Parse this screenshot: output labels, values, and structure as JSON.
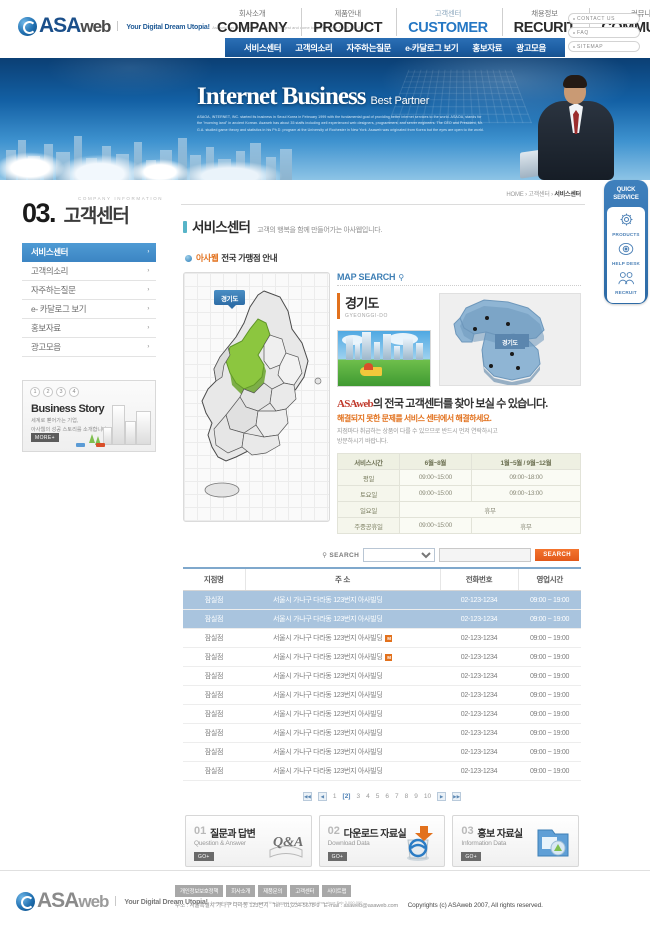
{
  "header": {
    "logo": {
      "brand": "ASA",
      "brand_sub": "web",
      "tagline": "Your Digital Dream Utopia!",
      "tagline_accent": "Utopia!",
      "tagline_sub": "Asaweb has been serving one of the biggest and come long time since Feb 3,000,000"
    },
    "nav": [
      {
        "kr": "회사소개",
        "en": "COMPANY",
        "active": false
      },
      {
        "kr": "제품안내",
        "en": "PRODUCT",
        "active": false
      },
      {
        "kr": "고객센터",
        "en": "CUSTOMER",
        "active": true
      },
      {
        "kr": "채용정보",
        "en": "RECURIT",
        "active": false
      },
      {
        "kr": "커뮤니티",
        "en": "COMMUNITY",
        "active": false
      }
    ],
    "utils": [
      "CONTACT US",
      "FAQ",
      "SITEMAP"
    ],
    "subnav": [
      "서비스센터",
      "고객의소리",
      "자주하는질문",
      "e-카달로그 보기",
      "홍보자료",
      "광고모음"
    ]
  },
  "hero": {
    "title": "Internet Business",
    "subtitle": "Best Partner",
    "desc": "ASAOA, INTERNET, INC. started its business in Seoul Korea in February 1999 with the fundamental goal of providing better internet services to the world. ASAOA, stands for the \"morning land\" in ancient Korean. Asaweb has about 35 staffs including well experienced web designers, programmers, and server engineers. The CEO and President, Mr. G.A. studied game theory and statistics in his Ph.D. program at the University of Rochester in New York. Asaweb was originated from Korea but the eyes are open to the world."
  },
  "left": {
    "eyebrow": "COMPANY INFORMATION",
    "number": "03.",
    "page_title": "고객센터",
    "menu": [
      {
        "label": "서비스센터",
        "active": true
      },
      {
        "label": "고객의소리",
        "active": false
      },
      {
        "label": "자주하는질문",
        "active": false
      },
      {
        "label": "e- 카달로그 보기",
        "active": false
      },
      {
        "label": "홍보자료",
        "active": false
      },
      {
        "label": "광고모음",
        "active": false
      }
    ],
    "promo": {
      "dots": [
        "1",
        "2",
        "3",
        "4"
      ],
      "title": "Business Story",
      "sub_line1": "세계로 뻗어가는 기업,",
      "sub_line2": "아사웹의 성공 스토리를 소개합니다.",
      "more": "MORE+"
    }
  },
  "main": {
    "breadcrumb": {
      "home": "HOME",
      "sep1": "›",
      "level1": "고객센터",
      "sep2": "›",
      "current": "서비스센터"
    },
    "title": "서비스센터",
    "subtitle": "고객의 행복을 함께 만들어가는 아사웹입니다.",
    "section": {
      "brand": "아사웹",
      "rest": "전국 가맹점 안내"
    },
    "map_search_label": "MAP SEARCH",
    "region": {
      "kr": "경기도",
      "en": "GYEONGGI-DO",
      "map_tip": "경기도",
      "region_tag": "경기도"
    },
    "desc": {
      "line1_brand": "ASAweb",
      "line1_rest": "의 전국 고객센터를 찾아 보실 수 있습니다.",
      "line2": "해결되지 못한 문제를 서비스 센터에서 해결하세요.",
      "line3a": "지점마다 취급하는 상품이 다를 수 있으므로 반드시 먼저 연락하시고",
      "line3b": "방문하시기 바랍니다."
    },
    "hours": {
      "headers": [
        "서비스시간",
        "6월~8월",
        "1월~5월 / 9월~12월"
      ],
      "rows": [
        [
          "평일",
          "09:00~15:00",
          "09:00~18:00"
        ],
        [
          "토요일",
          "09:00~15:00",
          "09:00~13:00"
        ],
        [
          "일요일",
          "휴무",
          ""
        ],
        [
          "주중공휴일",
          "09:00~15:00",
          "휴무"
        ]
      ]
    },
    "search": {
      "label": "SEARCH",
      "select_value": "",
      "input_value": "",
      "input_placeholder": "",
      "button": "SEARCH"
    },
    "table": {
      "headers": [
        "지점명",
        "주  소",
        "전화번호",
        "영업시간"
      ],
      "rows": [
        {
          "name": "잠실점",
          "addr": "서울시 가나구 다라동 123번지 아사빌딩",
          "map": false,
          "tel": "02-123-1234",
          "hours": "09:00 ~ 19:00",
          "hl": true
        },
        {
          "name": "잠실점",
          "addr": "서울시 가나구 다라동 123번지 아사빌딩",
          "map": false,
          "tel": "02-123-1234",
          "hours": "09:00 ~ 19:00",
          "hl": true
        },
        {
          "name": "잠실점",
          "addr": "서울시 가나구 다라동 123번지 아사빌딩",
          "map": true,
          "tel": "02-123-1234",
          "hours": "09:00 ~ 19:00",
          "hl": false
        },
        {
          "name": "잠실점",
          "addr": "서울시 가나구 다라동 123번지 아사빌딩",
          "map": true,
          "tel": "02-123-1234",
          "hours": "09:00 ~ 19:00",
          "hl": false
        },
        {
          "name": "잠실점",
          "addr": "서울시 가나구 다라동 123번지 아사빌딩",
          "map": false,
          "tel": "02-123-1234",
          "hours": "09:00 ~ 19:00",
          "hl": false
        },
        {
          "name": "잠실점",
          "addr": "서울시 가나구 다라동 123번지 아사빌딩",
          "map": false,
          "tel": "02-123-1234",
          "hours": "09:00 ~ 19:00",
          "hl": false
        },
        {
          "name": "잠실점",
          "addr": "서울시 가나구 다라동 123번지 아사빌딩",
          "map": false,
          "tel": "02-123-1234",
          "hours": "09:00 ~ 19:00",
          "hl": false
        },
        {
          "name": "잠실점",
          "addr": "서울시 가나구 다라동 123번지 아사빌딩",
          "map": false,
          "tel": "02-123-1234",
          "hours": "09:00 ~ 19:00",
          "hl": false
        },
        {
          "name": "잠실점",
          "addr": "서울시 가나구 다라동 123번지 아사빌딩",
          "map": false,
          "tel": "02-123-1234",
          "hours": "09:00 ~ 19:00",
          "hl": false
        },
        {
          "name": "잠실점",
          "addr": "서울시 가나구 다라동 123번지 아사빌딩",
          "map": false,
          "tel": "02-123-1234",
          "hours": "09:00 ~ 19:00",
          "hl": false
        }
      ]
    },
    "pager": {
      "first": "◀◀",
      "prev": "◀",
      "pages": [
        "1",
        "[2]",
        "3",
        "4",
        "5",
        "6",
        "7",
        "8",
        "9",
        "10"
      ],
      "active_index": 1,
      "next": "▶",
      "last": "▶▶"
    },
    "boxes": [
      {
        "num": "01",
        "kr": "질문과 답변",
        "en": "Question & Answer",
        "go": "GO+",
        "icon": "qa-icon"
      },
      {
        "num": "02",
        "kr": "다운로드 자료실",
        "en": "Download Data",
        "go": "GO+",
        "icon": "download-icon"
      },
      {
        "num": "03",
        "kr": "홍보 자료실",
        "en": "Information Data",
        "go": "GO+",
        "icon": "folder-icon"
      }
    ]
  },
  "quick": {
    "title_l1": "QUICK",
    "title_l2": "SERVICE",
    "items": [
      {
        "label": "PRODUCTS",
        "icon": "gear-icon"
      },
      {
        "label": "HELP DESK",
        "icon": "phone-icon"
      },
      {
        "label": "RECRUIT",
        "icon": "people-icon"
      }
    ]
  },
  "footer": {
    "links": [
      "개인정보보호정책",
      "회사소개",
      "제품문의",
      "고객센터",
      "사이트맵"
    ],
    "address": "주소 : 서울특별시 가나구 다라동 123번지",
    "tel": "Tel : 01)234-5678-9",
    "email": "E-mail : asaweb@asaweb.com",
    "copyright": "Copyrights (c) ASAweb 2007, All rights reserved."
  },
  "colors": {
    "accent_blue": "#2477c4",
    "nav_blue": "#1d5ea3",
    "orange": "#e2711d",
    "highlight_row": "#a9c4de"
  }
}
